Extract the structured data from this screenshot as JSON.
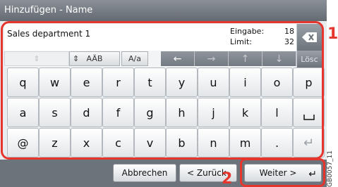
{
  "title": "Hinzufügen - Name",
  "entry": {
    "text": "Sales department 1",
    "input_label": "Eingabe:",
    "input_value": "18",
    "limit_label": "Limit:",
    "limit_value": "32"
  },
  "side": {
    "backspace_icon": "backspace-icon",
    "delete_label": "Lösc"
  },
  "mode": {
    "charset_label": "AÄB",
    "case_label": "A/a"
  },
  "arrows": [
    "←",
    "→",
    "↑",
    "↓"
  ],
  "keys": {
    "row1": [
      "q",
      "w",
      "e",
      "r",
      "t",
      "y",
      "u",
      "i",
      "o",
      "p"
    ],
    "row2": [
      "a",
      "s",
      "d",
      "f",
      "g",
      "h",
      "j",
      "k",
      "l"
    ],
    "row3": [
      "@",
      "z",
      "x",
      "c",
      "v",
      "b",
      "n",
      "m",
      "."
    ]
  },
  "buttons": {
    "cancel": "Abbrechen",
    "back": "< Zurück",
    "next": "Weiter >"
  },
  "callouts": {
    "one": "1",
    "two": "2"
  },
  "figure_id": "GB0057_11",
  "colors": {
    "accent": "#e5352d",
    "title_bar": "#6d737a"
  }
}
